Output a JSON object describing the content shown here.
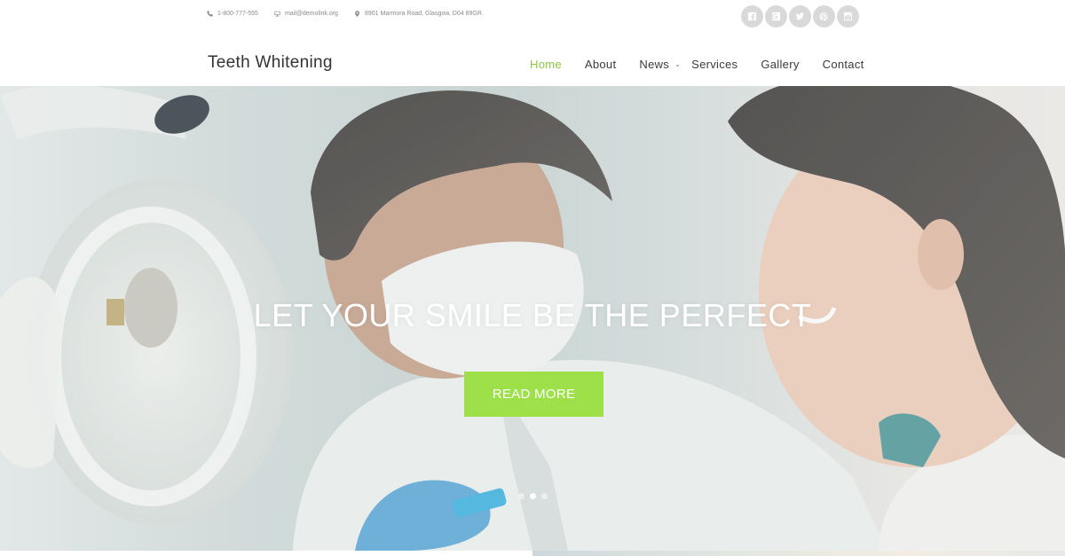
{
  "topbar": {
    "phone": "1-800-777-555",
    "email": "mail@demolink.org",
    "address": "8901 Marmora Road, Glasgow, D04 89GR.",
    "socials": [
      "facebook-icon",
      "google-plus-icon",
      "twitter-icon",
      "pinterest-icon",
      "instagram-icon"
    ]
  },
  "header": {
    "logo": "Teeth Whitening",
    "nav": [
      {
        "label": "Home",
        "active": true
      },
      {
        "label": "About"
      },
      {
        "label": "News",
        "dropdown": true
      },
      {
        "label": "Services"
      },
      {
        "label": "Gallery"
      },
      {
        "label": "Contact"
      }
    ]
  },
  "hero": {
    "title": "LET YOUR SMILE BE THE PERFECT",
    "button": "READ MORE",
    "slides": 3,
    "active_slide": 2
  },
  "colors": {
    "accent": "#8cc63f",
    "button": "#9ee04a",
    "social_bg": "#d9d9d9"
  }
}
